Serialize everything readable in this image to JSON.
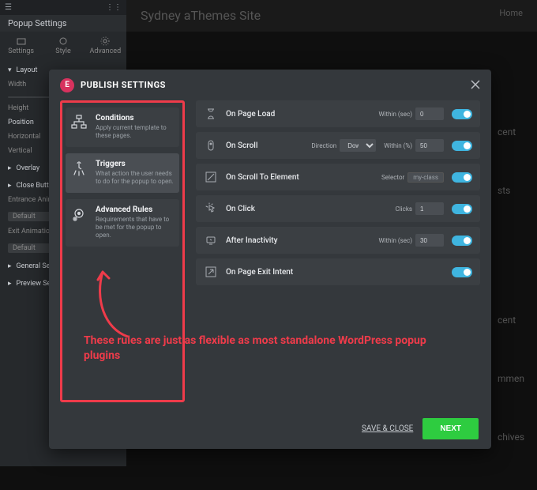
{
  "background": {
    "panel_title": "Popup Settings",
    "tabs": [
      {
        "label": "Settings"
      },
      {
        "label": "Style"
      },
      {
        "label": "Advanced"
      }
    ],
    "sections": {
      "layout": "Layout",
      "overlay": "Overlay",
      "close_button": "Close Button",
      "general": "General Se",
      "preview": "Preview Se"
    },
    "rows": {
      "width": "Width",
      "height": "Height",
      "position": "Position",
      "horizontal": "Horizontal",
      "vertical": "Vertical",
      "entrance": "Entrance Anim",
      "entrance_val": "Default",
      "exit": "Exit Animation",
      "exit_val": "Default"
    },
    "site_title": "Sydney aThemes Site",
    "nav_home": "Home",
    "right": {
      "a": "cent",
      "b": "sts",
      "c": "cent",
      "d": "mmen",
      "e": "chives"
    }
  },
  "modal": {
    "title": "PUBLISH SETTINGS",
    "left_items": [
      {
        "title": "Conditions",
        "desc": "Apply current template to these pages.",
        "active": false
      },
      {
        "title": "Triggers",
        "desc": "What action the user needs to do for the popup to open.",
        "active": true
      },
      {
        "title": "Advanced Rules",
        "desc": "Requirements that have to be met for the popup to open.",
        "active": false
      }
    ],
    "triggers": [
      {
        "label": "On Page Load",
        "plabel": "Within (sec)",
        "ptype": "input",
        "pvalue": "0",
        "on": true
      },
      {
        "label": "On Scroll",
        "dir_label": "Direction",
        "dir_value": "Down",
        "plabel": "Within (%)",
        "ptype": "input",
        "pvalue": "50",
        "on": true
      },
      {
        "label": "On Scroll To Element",
        "plabel": "Selector",
        "ptype": "readonly",
        "pvalue": "my-class",
        "on": true
      },
      {
        "label": "On Click",
        "plabel": "Clicks",
        "ptype": "input",
        "pvalue": "1",
        "on": true
      },
      {
        "label": "After Inactivity",
        "plabel": "Within (sec)",
        "ptype": "input",
        "pvalue": "30",
        "on": true
      },
      {
        "label": "On Page Exit Intent",
        "on": true
      }
    ],
    "footer": {
      "save_close": "SAVE & CLOSE",
      "next": "NEXT"
    }
  },
  "annotation": "These rules are just as flexible as most standalone WordPress popup plugins"
}
